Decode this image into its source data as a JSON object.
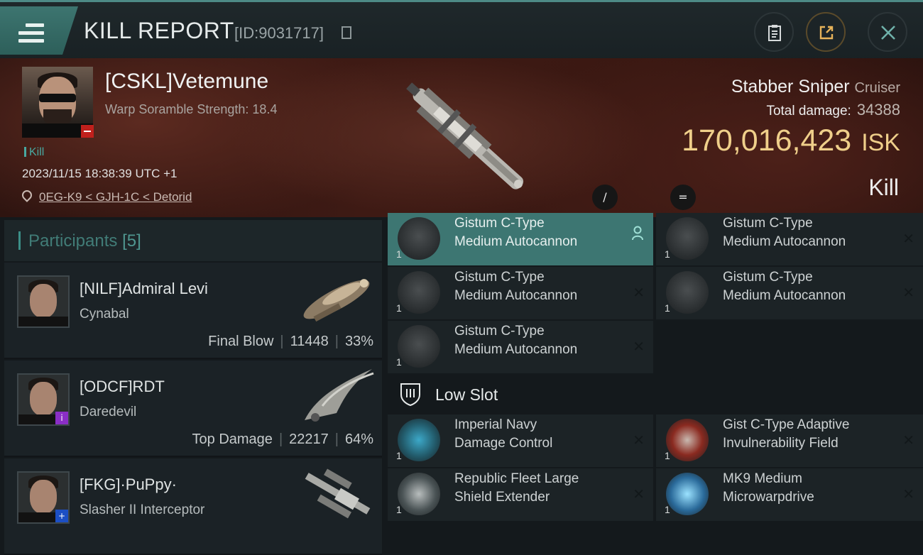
{
  "header": {
    "title": "KILL REPORT",
    "report_id": "[ID:9031717]",
    "icons": [
      "menu-icon",
      "copy-icon",
      "clipboard-icon",
      "share-icon",
      "close-icon"
    ]
  },
  "victim": {
    "name": "[CSKL]Vetemune",
    "scramble": "Warp Soramble Strength: 18.4",
    "tag": "Kill",
    "datetime": "2023/11/15 18:38:39 UTC +1",
    "location": "0EG-K9 < GJH-1C < Detorid",
    "ship": "Stabber Sniper",
    "ship_class": "Cruiser",
    "damage_label": "Total damage:",
    "damage": "34388",
    "isk_value": "170,016,423",
    "isk_currency": "ISK",
    "result": "Kill",
    "controls": [
      "/",
      "="
    ]
  },
  "participants": {
    "label": "Participants",
    "count": "[5]",
    "list": [
      {
        "name": "[NILF]Admiral Levi",
        "ship": "Cynabal",
        "role": "Final Blow",
        "damage": "11448",
        "percent": "33%"
      },
      {
        "name": "[ODCF]RDT",
        "ship": "Daredevil",
        "role": "Top Damage",
        "damage": "22217",
        "percent": "64%"
      },
      {
        "name": "[FKG]·PuPpy·",
        "ship": "Slasher II Interceptor",
        "role": "",
        "damage": "",
        "percent": ""
      }
    ]
  },
  "modules": {
    "items": [
      {
        "line1": "Gistum C-Type",
        "line2": "Medium Autocannon",
        "qty": "1"
      },
      {
        "line1": "Gistum C-Type",
        "line2": "Medium Autocannon",
        "qty": "1"
      },
      {
        "line1": "Gistum C-Type",
        "line2": "Medium Autocannon",
        "qty": "1"
      },
      {
        "line1": "Gistum C-Type",
        "line2": "Medium Autocannon",
        "qty": "1"
      },
      {
        "line1": "Gistum C-Type",
        "line2": "Medium Autocannon",
        "qty": "1"
      }
    ],
    "low_slot_label": "Low Slot",
    "low_items": [
      {
        "line1": "Imperial Navy",
        "line2": "Damage Control",
        "qty": "1"
      },
      {
        "line1": "Gist C-Type Adaptive",
        "line2": "Invulnerability Field",
        "qty": "1"
      },
      {
        "line1": "Republic Fleet Large",
        "line2": "Shield Extender",
        "qty": "1"
      },
      {
        "line1": "MK9 Medium",
        "line2": "Microwarpdrive",
        "qty": "1"
      }
    ]
  },
  "colors": {
    "accent": "#3d7672",
    "isk": "#efcf8a",
    "panel": "#1c2326"
  }
}
